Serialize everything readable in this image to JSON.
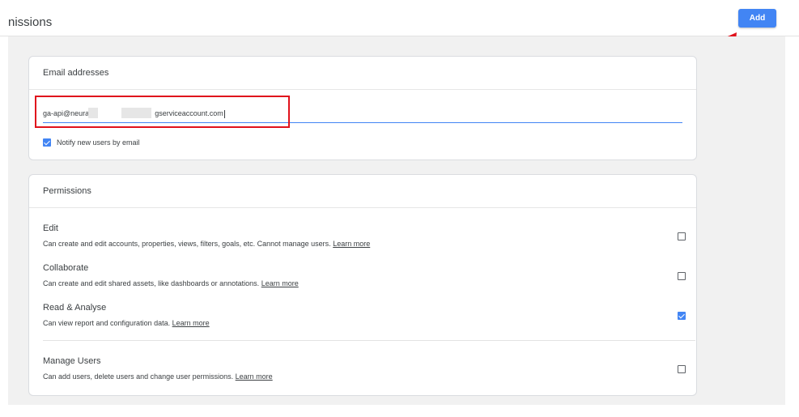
{
  "header": {
    "title": "nissions",
    "add_label": "Add"
  },
  "email_card": {
    "title": "Email addresses",
    "input_part1": "ga-api@neura",
    "input_part2": "gserviceaccount.com",
    "notify_label": "Notify new users by email",
    "notify_checked": true
  },
  "permissions_card": {
    "title": "Permissions",
    "items": [
      {
        "name": "Edit",
        "description": "Can create and edit accounts, properties, views, filters, goals, etc. Cannot manage users.",
        "link": "Learn more",
        "checked": false
      },
      {
        "name": "Collaborate",
        "description": "Can create and edit shared assets, like dashboards or annotations.",
        "link": "Learn more",
        "checked": false
      },
      {
        "name": "Read & Analyse",
        "description": "Can view report and configuration data.",
        "link": "Learn more",
        "checked": true
      },
      {
        "name": "Manage Users",
        "description": "Can add users, delete users and change user permissions.",
        "link": "Learn more",
        "checked": false
      }
    ]
  },
  "colors": {
    "accent": "#4285f4",
    "annotation_red": "#e0121c",
    "background": "#f1f1f1"
  }
}
